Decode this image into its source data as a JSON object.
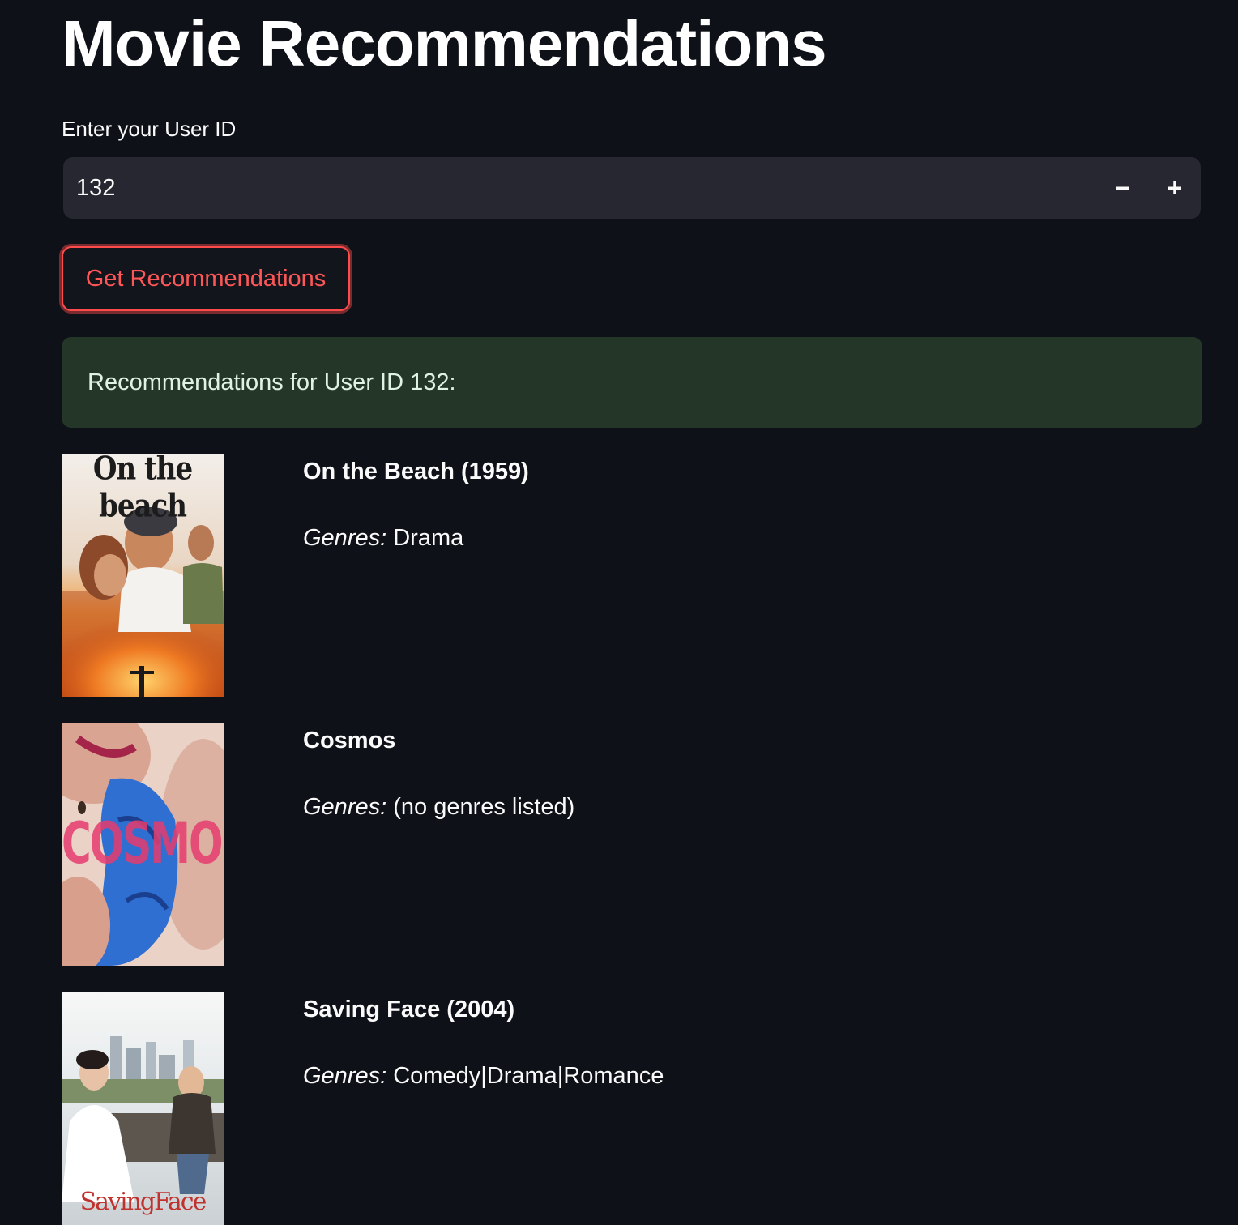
{
  "page": {
    "title": "Movie Recommendations"
  },
  "user_input": {
    "label": "Enter your User ID",
    "value": "132"
  },
  "actions": {
    "get_recommendations_label": "Get Recommendations"
  },
  "success_message": "Recommendations for User ID 132:",
  "genres_label": "Genres:",
  "movies": [
    {
      "title": "On the Beach (1959)",
      "genres": "Drama",
      "poster_text": "On the beach"
    },
    {
      "title": "Cosmos",
      "genres": "(no genres listed)",
      "poster_text": "COSMOS"
    },
    {
      "title": "Saving Face (2004)",
      "genres": "Comedy|Drama|Romance",
      "poster_text": "SavingFace"
    }
  ],
  "colors": {
    "background": "#0e1117",
    "input_bg": "#262730",
    "accent": "#ff4b4b",
    "success_bg": "#233628"
  },
  "icons": {
    "decrement": "minus-icon",
    "increment": "plus-icon"
  }
}
